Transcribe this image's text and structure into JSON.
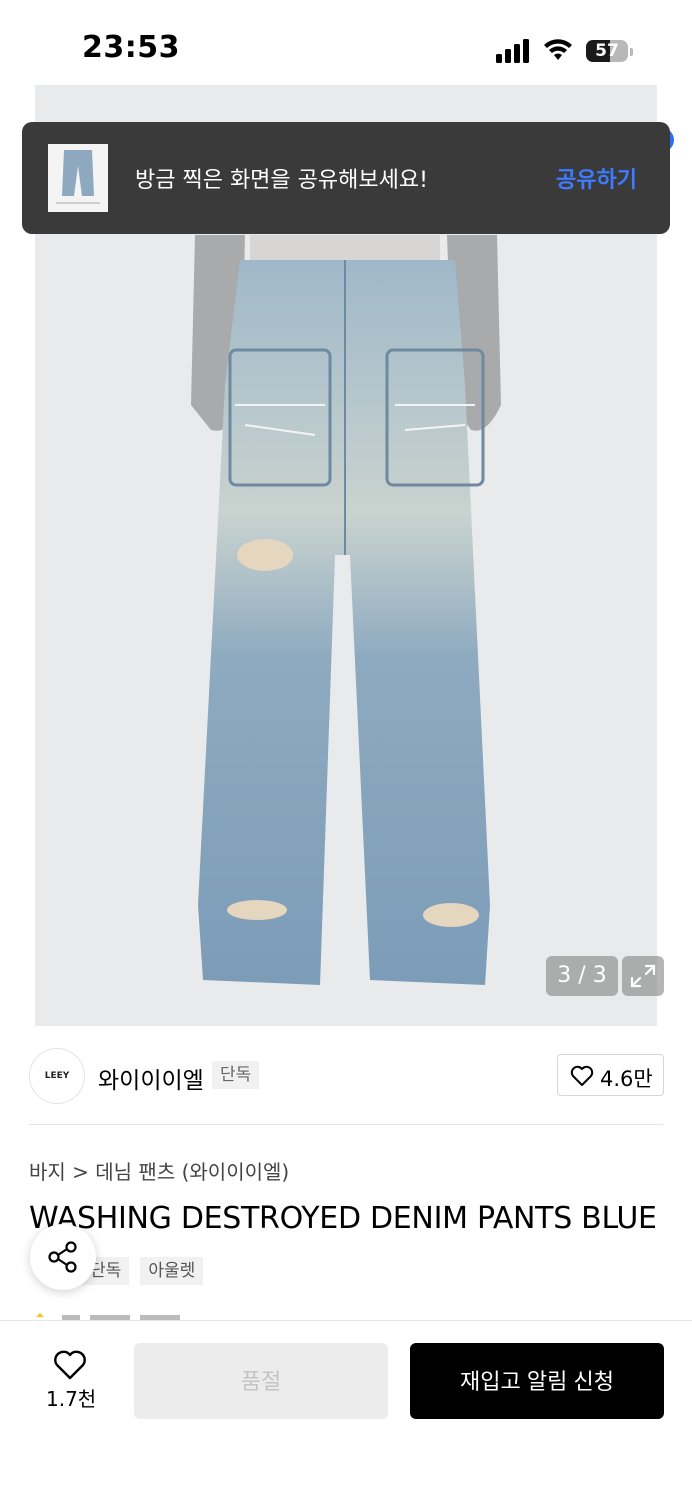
{
  "status_bar": {
    "time": "23:53",
    "battery": "57"
  },
  "product_image": {
    "counter": "3 / 3"
  },
  "toast": {
    "message": "방금 찍은 화면을 공유해보세요!",
    "action": "공유하기"
  },
  "brand": {
    "logo_text": "LEEY",
    "name": "와이이이엘",
    "badge": "단독",
    "likes": "4.6만"
  },
  "product": {
    "breadcrumb": "바지 > 데님 팬츠 (와이이이엘)",
    "title": "WASHING DESTROYED DENIM PANTS BLUE",
    "tags": [
      "단독",
      "아울렛"
    ]
  },
  "bottom_bar": {
    "wish_count": "1.7천",
    "soldout_label": "품절",
    "restock_label": "재입고 알림 신청"
  },
  "colors": {
    "accent": "#3e7bff",
    "toast_bg": "#3a3a3a",
    "primary_button": "#000000"
  }
}
